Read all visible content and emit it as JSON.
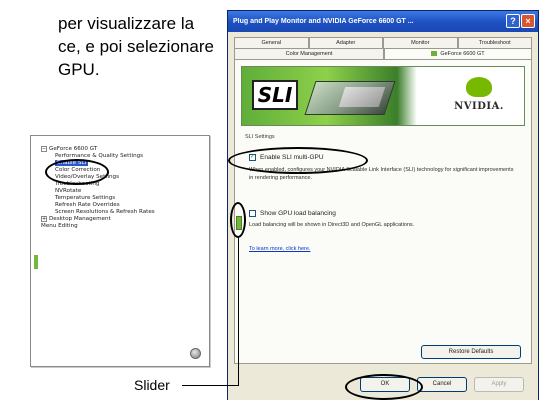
{
  "intro_text": "per visualizzare la\nce, e poi selezionare\nGPU.",
  "tree": {
    "items": [
      {
        "label": "GeForce 6600 GT",
        "level": 1,
        "expander": "−"
      },
      {
        "label": "Performance & Quality Settings",
        "level": 2
      },
      {
        "label": "Enable SLI",
        "level": 2,
        "selected": true
      },
      {
        "label": "Color Correction",
        "level": 2
      },
      {
        "label": "Video/Overlay Settings",
        "level": 2
      },
      {
        "label": "Troubleshooting",
        "level": 2
      },
      {
        "label": "NVRotate",
        "level": 2
      },
      {
        "label": "Temperature Settings",
        "level": 2
      },
      {
        "label": "Refresh Rate Overrides",
        "level": 2
      },
      {
        "label": "Screen Resolutions & Refresh Rates",
        "level": 2
      },
      {
        "label": "Desktop Management",
        "level": 1,
        "expander": "+"
      },
      {
        "label": "Menu Editing",
        "level": 1
      }
    ]
  },
  "dialog": {
    "title": "Plug and Play Monitor and NVIDIA GeForce 6600 GT ...",
    "help_glyph": "?",
    "close_glyph": "×",
    "tabs_row1": [
      "General",
      "Adapter",
      "Monitor",
      "Troubleshoot"
    ],
    "tabs_row2": [
      "Color Management",
      "GeForce 6600 GT"
    ],
    "banner": {
      "sli_text": "SLI",
      "nvidia_text": "NVIDIA."
    },
    "section_label": "SLI Settings",
    "enable_sli_label": "Enable SLI multi-GPU",
    "enable_sli_desc": "When enabled, configures your NVIDIA Scalable Link Interface (SLI) technology for significant improvements in rendering performance.",
    "load_balancing_label": "Show GPU load balancing",
    "load_balancing_desc": "Load balancing will be shown in Direct3D and OpenGL applications.",
    "learn_more_link": "To learn more, click here.",
    "restore_defaults": "Restore Defaults",
    "ok": "OK",
    "cancel": "Cancel",
    "apply": "Apply"
  },
  "slider_caption": "Slider",
  "colors": {
    "accent_green": "#76b900",
    "selection_blue": "#2b57c9",
    "xp_title_blue": "#1d4fc0"
  }
}
